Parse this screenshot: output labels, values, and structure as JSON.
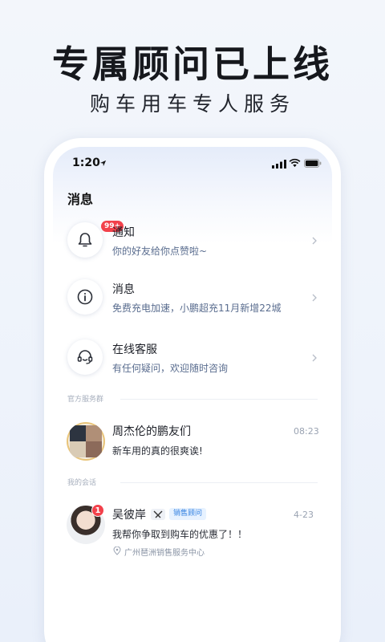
{
  "promo": {
    "headline": "专属顾问已上线",
    "subline": "购车用车专人服务"
  },
  "status_bar": {
    "time": "1:20"
  },
  "screen": {
    "title": "消息"
  },
  "rows": [
    {
      "icon": "bell-icon",
      "badge": "99+",
      "title": "通知",
      "subtitle": "你的好友给你点赞啦~"
    },
    {
      "icon": "info-icon",
      "title": "消息",
      "subtitle": "免费充电加速，小鹏超充11月新增22城"
    },
    {
      "icon": "headset-icon",
      "title": "在线客服",
      "subtitle": "有任何疑问，欢迎随时咨询"
    }
  ],
  "sections": {
    "official_group": "官方服务群",
    "my_chats": "我的会话"
  },
  "group_chat": {
    "name": "周杰伦的鹏友们",
    "time": "08:23",
    "message": "新车用的真的很爽诶!"
  },
  "personal_chat": {
    "name": "吴彼岸",
    "badge": "1",
    "role_tag": "销售顾问",
    "time": "4-23",
    "message": "我帮你争取到购车的优惠了！！",
    "location": "广州琶洲销售服务中心"
  },
  "colors": {
    "accent_blue": "#2f7fe0",
    "badge_red": "#f2414b",
    "subtitle": "#5a6d8f"
  }
}
